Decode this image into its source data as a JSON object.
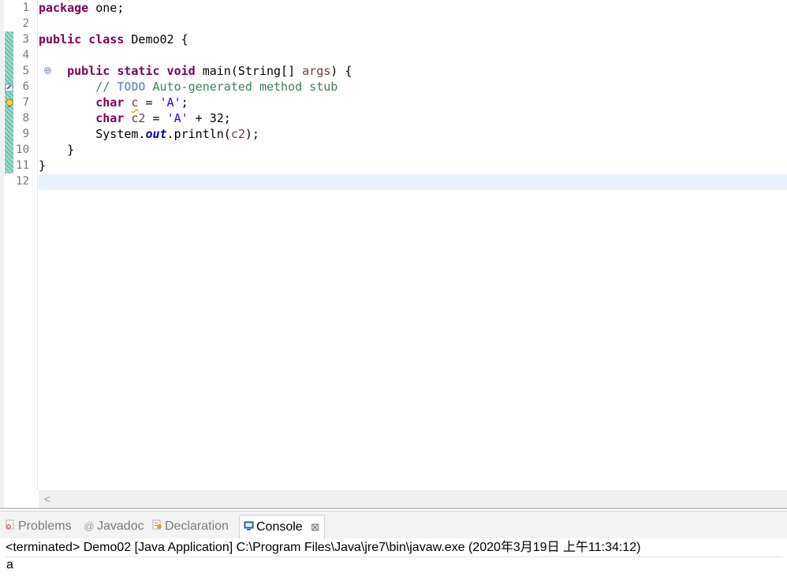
{
  "editor": {
    "line_numbers": [
      "1",
      "2",
      "3",
      "4",
      "5",
      "6",
      "7",
      "8",
      "9",
      "10",
      "11",
      "12"
    ],
    "fold_marker": "⊖",
    "code_tokens": {
      "l1_kw": "package",
      "l1_rest": " one;",
      "l3_kw": "public class",
      "l3_rest": " Demo02 {",
      "l5_indent": "    ",
      "l5_kw": "public static void",
      "l5_rest": " main(String[] ",
      "l5_param": "args",
      "l5_end": ") {",
      "l6_indent": "        ",
      "l6_comment": "// ",
      "l6_todo": "TODO",
      "l6_comment_rest": " Auto-generated method stub",
      "l7_indent": "        ",
      "l7_kw": "char",
      "l7_sp": " ",
      "l7_var": "c",
      "l7_eq": " = ",
      "l7_str": "'A'",
      "l7_end": ";",
      "l8_indent": "        ",
      "l8_kw": "char",
      "l8_sp": " ",
      "l8_var": "c2",
      "l8_eq": " = ",
      "l8_str": "'A'",
      "l8_end": " + 32;",
      "l9_indent": "        ",
      "l9_a": "System.",
      "l9_field": "out",
      "l9_b": ".println(",
      "l9_var": "c2",
      "l9_c": ");",
      "l10": "    }",
      "l11": "}"
    },
    "hscroll_left": "<"
  },
  "panel": {
    "tabs": [
      {
        "label": "Problems",
        "icon": "problems-icon"
      },
      {
        "label": "Javadoc",
        "icon": "javadoc-icon",
        "glyph": "@"
      },
      {
        "label": "Declaration",
        "icon": "declaration-icon"
      },
      {
        "label": "Console",
        "icon": "console-icon",
        "close": "⊠"
      }
    ],
    "console_status": "<terminated> Demo02 [Java Application] C:\\Program Files\\Java\\jre7\\bin\\javaw.exe (2020年3月19日 上午11:34:12)",
    "console_output": "a"
  },
  "colors": {
    "keyword": "#7f0055",
    "comment": "#3f7f5f",
    "string": "#2a00ff",
    "field": "#0000c0",
    "current_line": "#e8f2fe"
  }
}
